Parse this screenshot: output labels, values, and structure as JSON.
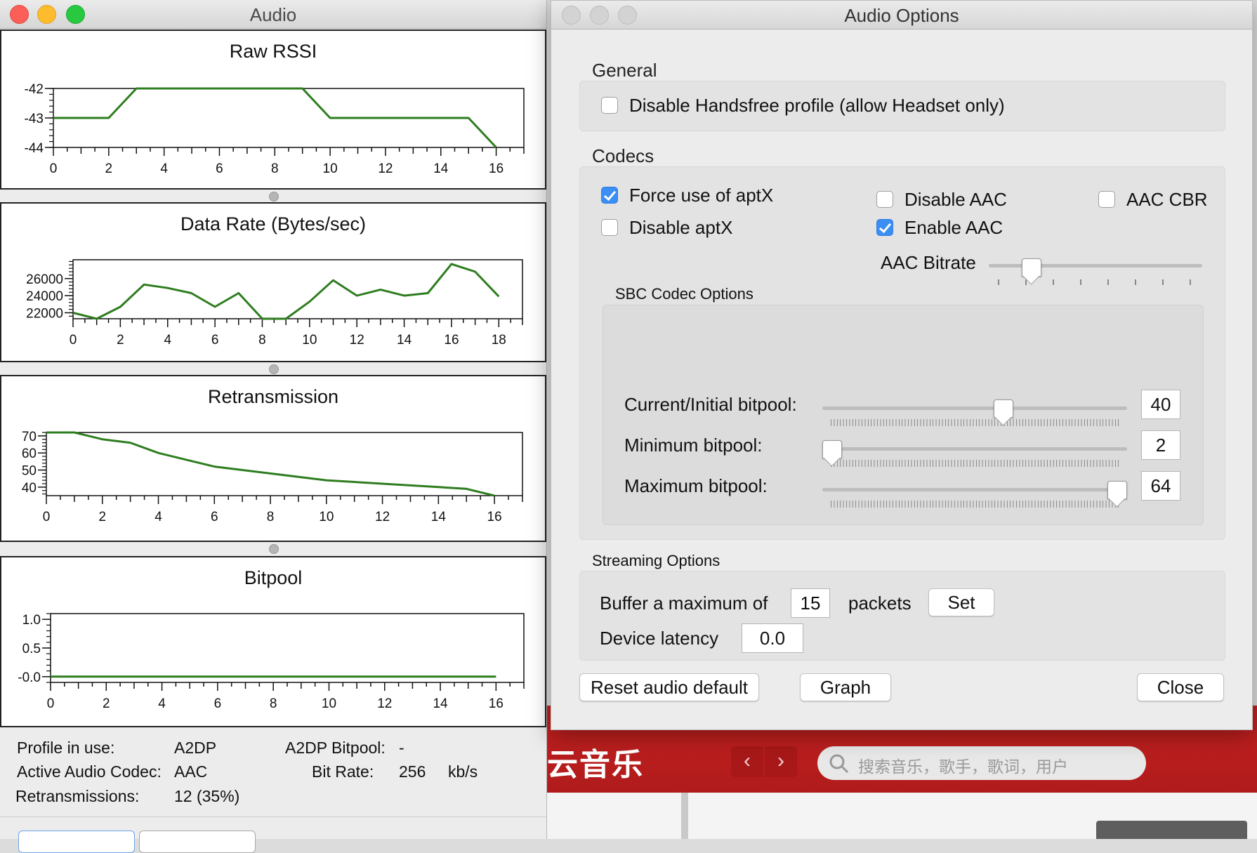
{
  "audio_window": {
    "title": "Audio",
    "graphs": {
      "rssi": {
        "title": "Raw RSSI"
      },
      "datarate": {
        "title": "Data Rate (Bytes/sec)"
      },
      "retrans": {
        "title": "Retransmission"
      },
      "bitpool": {
        "title": "Bitpool"
      }
    },
    "stats": {
      "profile_label": "Profile in use:",
      "profile_value": "A2DP",
      "a2dp_bitpool_label": "A2DP Bitpool:",
      "a2dp_bitpool_value": "-",
      "codec_label": "Active Audio Codec:",
      "codec_value": "AAC",
      "bitrate_label": "Bit Rate:",
      "bitrate_value": "256",
      "bitrate_unit": "kb/s",
      "retrans_label": "Retransmissions:",
      "retrans_value": "12 (35%)"
    }
  },
  "chart_data": [
    {
      "type": "line",
      "title": "Raw RSSI",
      "x": [
        0,
        2,
        3,
        9,
        10,
        15,
        16
      ],
      "series": [
        {
          "values": [
            -43,
            -43,
            -42,
            -42,
            -43,
            -43,
            -44
          ]
        }
      ],
      "xlim": [
        0,
        17
      ],
      "ylim": [
        -44,
        -42
      ],
      "x_ticks": [
        0,
        2,
        4,
        6,
        8,
        10,
        12,
        14,
        16
      ],
      "y_ticks": [
        -42,
        -43,
        -44
      ],
      "color": "#2e7d1f"
    },
    {
      "type": "line",
      "title": "Data Rate (Bytes/sec)",
      "x": [
        0,
        1,
        2,
        3,
        4,
        5,
        6,
        7,
        8,
        9,
        10,
        11,
        12,
        13,
        14,
        15,
        16,
        17,
        18
      ],
      "series": [
        {
          "values": [
            22000,
            21300,
            22700,
            25300,
            24900,
            24300,
            22700,
            24300,
            21300,
            21300,
            23300,
            25800,
            24000,
            24700,
            24000,
            24300,
            27700,
            26800,
            23900
          ]
        }
      ],
      "xlim": [
        0,
        19
      ],
      "ylim": [
        21300,
        28200
      ],
      "x_ticks": [
        0,
        2,
        4,
        6,
        8,
        10,
        12,
        14,
        16,
        18
      ],
      "y_ticks": [
        26000,
        24000,
        22000
      ],
      "color": "#2e7d1f"
    },
    {
      "type": "line",
      "title": "Retransmission",
      "x": [
        0,
        1,
        2,
        3,
        4,
        5,
        6,
        7,
        8,
        9,
        10,
        11,
        12,
        13,
        14,
        15,
        16
      ],
      "series": [
        {
          "values": [
            72,
            72,
            68,
            66,
            60,
            56,
            52,
            50,
            48,
            46,
            44,
            43,
            42,
            41,
            40,
            39,
            35
          ]
        }
      ],
      "xlim": [
        0,
        17
      ],
      "ylim": [
        35,
        72
      ],
      "x_ticks": [
        0,
        2,
        4,
        6,
        8,
        10,
        12,
        14,
        16
      ],
      "y_ticks": [
        70,
        60,
        50,
        40
      ],
      "color": "#2e7d1f"
    },
    {
      "type": "line",
      "title": "Bitpool",
      "x": [
        0,
        16
      ],
      "series": [
        {
          "values": [
            0,
            0
          ]
        }
      ],
      "xlim": [
        0,
        17
      ],
      "ylim": [
        -0.1,
        1.1
      ],
      "x_ticks": [
        0,
        2,
        4,
        6,
        8,
        10,
        12,
        14,
        16
      ],
      "y_ticks": [
        "1.0",
        "0.5",
        "-0.0"
      ],
      "y_tick_values": [
        1.0,
        0.5,
        0.0
      ],
      "color": "#2e7d1f"
    }
  ],
  "options_window": {
    "title": "Audio Options",
    "general": {
      "label": "General",
      "disable_handsfree": {
        "label": "Disable Handsfree profile (allow Headset only)",
        "checked": false
      }
    },
    "codecs": {
      "label": "Codecs",
      "force_aptx": {
        "label": "Force use of aptX",
        "checked": true
      },
      "disable_aptx": {
        "label": "Disable aptX",
        "checked": false
      },
      "disable_aac": {
        "label": "Disable AAC",
        "checked": false
      },
      "enable_aac": {
        "label": "Enable AAC",
        "checked": true
      },
      "aac_cbr": {
        "label": "AAC CBR",
        "checked": false
      },
      "aac_bitrate_label": "AAC Bitrate",
      "aac_bitrate_level": 0.17
    },
    "sbc": {
      "label": "SBC Codec Options",
      "current_label": "Current/Initial bitpool:",
      "current_value": "40",
      "current_level": 0.6,
      "min_label": "Minimum bitpool:",
      "min_value": "2",
      "min_level": 0.0,
      "max_label": "Maximum bitpool:",
      "max_value": "64",
      "max_level": 1.0
    },
    "streaming": {
      "label": "Streaming Options",
      "buffer_label": "Buffer a maximum of",
      "buffer_value": "15",
      "packets_label": "packets",
      "set_label": "Set",
      "latency_label": "Device latency",
      "latency_value": "0.0"
    },
    "buttons": {
      "reset": "Reset audio default",
      "graph": "Graph",
      "close": "Close"
    }
  },
  "background_app": {
    "title": "云音乐",
    "search_placeholder": "搜索音乐，歌手，歌词，用户",
    "back_icon": "chevron-left-icon",
    "forward_icon": "chevron-right-icon"
  },
  "colors": {
    "series": "#2e7d1f",
    "checkbox_on": "#3b8ef4",
    "bg_app_red": "#c52120"
  }
}
